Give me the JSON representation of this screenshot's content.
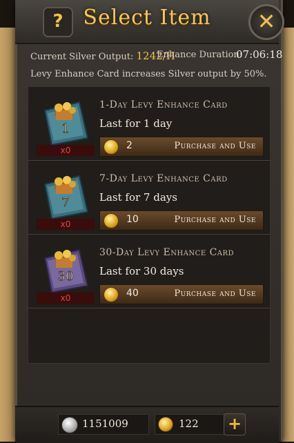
{
  "header": {
    "title": "Select Item",
    "help_glyph": "?",
    "close_glyph": "✕"
  },
  "info": {
    "silver_label": "Current Silver Output:",
    "silver_value": "1242/H",
    "duration_label": "Enhance Duration:",
    "duration_value": "07:06:18",
    "note": "Levy Enhance Card increases Silver output by 50%."
  },
  "items": [
    {
      "name": "1-Day Levy Enhance Card",
      "desc": "Last for 1 day",
      "count": "x0",
      "price": "2",
      "button": "Purchase and Use",
      "card_number": "1"
    },
    {
      "name": "7-Day Levy Enhance Card",
      "desc": "Last for 7 days",
      "count": "x0",
      "price": "10",
      "button": "Purchase and Use",
      "card_number": "7"
    },
    {
      "name": "30-Day Levy Enhance Card",
      "desc": "Last for 30 days",
      "count": "x0",
      "price": "40",
      "button": "Purchase and Use",
      "card_number": "30"
    }
  ],
  "footer": {
    "silver": "1151009",
    "gold": "122",
    "plus_glyph": "+"
  },
  "colors": {
    "gold": "#f2c24b",
    "count_red": "#e04545",
    "button_brown": "#6a4a2c"
  }
}
